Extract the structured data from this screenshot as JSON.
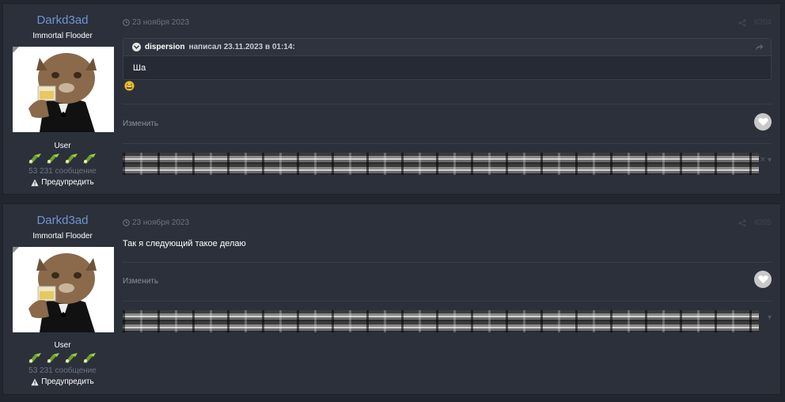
{
  "posts": [
    {
      "author": {
        "name": "Darkd3ad",
        "title": "Immortal Flooder",
        "group": "User",
        "post_count": "53 231 сообщение",
        "warn_label": "Предупредить"
      },
      "date": "23 ноября 2023",
      "number": "#204",
      "quote": {
        "author": "dispersion",
        "meta": "написал 23.11.2023 в 01:14:",
        "text": "Ша"
      },
      "edit_label": "Изменить"
    },
    {
      "author": {
        "name": "Darkd3ad",
        "title": "Immortal Flooder",
        "group": "User",
        "post_count": "53 231 сообщение",
        "warn_label": "Предупредить"
      },
      "date": "23 ноября 2023",
      "number": "#205",
      "text": "Так я следующий такое делаю",
      "edit_label": "Изменить"
    }
  ],
  "colors": {
    "author_name": "#6d95cf",
    "post_bg": "#2b303b",
    "page_bg": "#22262f"
  },
  "icons": [
    "clock-icon",
    "share-icon",
    "quote-toggle-icon",
    "quote-jump-icon",
    "laughing-emoji-icon",
    "heart-icon",
    "warning-icon",
    "badge-icon"
  ]
}
